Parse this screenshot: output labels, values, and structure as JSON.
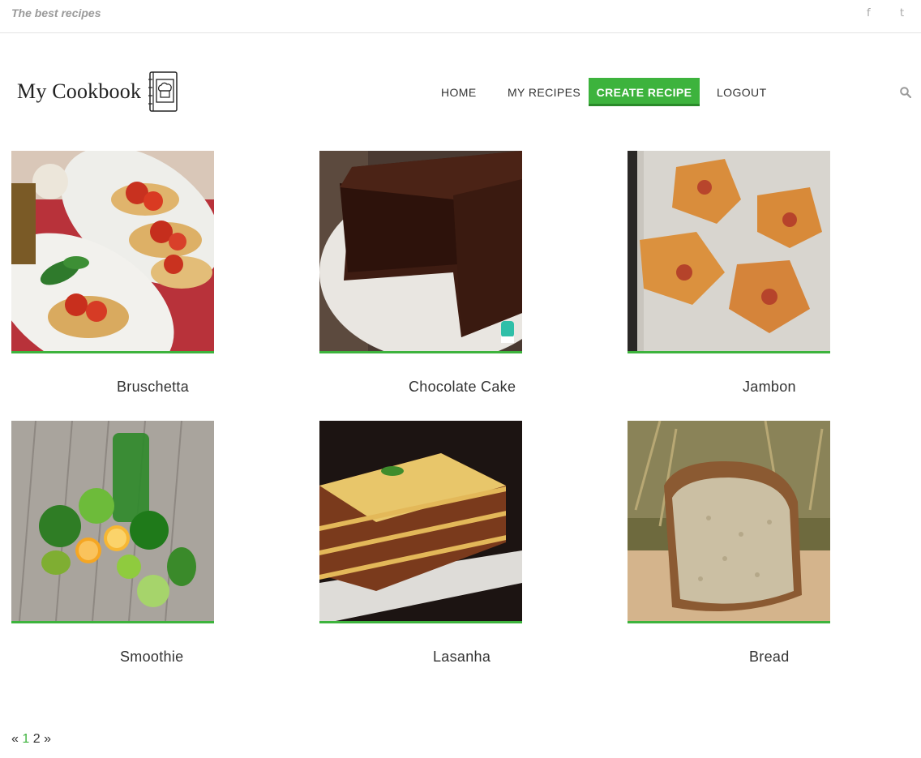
{
  "topbar": {
    "tagline": "The best recipes",
    "facebook": "f",
    "twitter": "t"
  },
  "header": {
    "logo_text": "My Cookbook"
  },
  "nav": {
    "home": "HOME",
    "my_recipes": "MY RECIPES",
    "create_recipe": "CREATE RECIPE",
    "logout": "LOGOUT"
  },
  "icons": {
    "search": "search-icon",
    "logo": "cookbook-chef-icon"
  },
  "colors": {
    "accent": "#3db33d"
  },
  "recipes": [
    {
      "title": "Bruschetta"
    },
    {
      "title": "Chocolate Cake"
    },
    {
      "title": "Jambon"
    },
    {
      "title": "Smoothie"
    },
    {
      "title": "Lasanha"
    },
    {
      "title": "Bread"
    }
  ],
  "pagination": {
    "prev": "«",
    "pages": [
      "1",
      "2"
    ],
    "next": "»",
    "current": "1"
  }
}
